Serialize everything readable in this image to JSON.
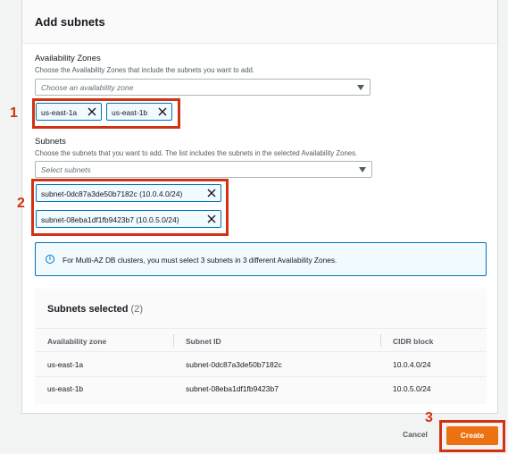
{
  "panel": {
    "title": "Add subnets"
  },
  "az": {
    "label": "Availability Zones",
    "description": "Choose the Availability Zones that include the subnets you want to add.",
    "placeholder": "Choose an availability zone",
    "tokens": [
      "us-east-1a",
      "us-east-1b"
    ]
  },
  "subnets": {
    "label": "Subnets",
    "description": "Choose the subnets that you want to add. The list includes the subnets in the selected Availability Zones.",
    "placeholder": "Select subnets",
    "tokens": [
      "subnet-0dc87a3de50b7182c (10.0.4.0/24)",
      "subnet-08eba1df1fb9423b7 (10.0.5.0/24)"
    ]
  },
  "info": {
    "text": "For Multi-AZ DB clusters, you must select 3 subnets in 3 different Availability Zones."
  },
  "selected": {
    "title": "Subnets selected",
    "count": "(2)",
    "columns": [
      "Availability zone",
      "Subnet ID",
      "CIDR block"
    ],
    "rows": [
      [
        "us-east-1a",
        "subnet-0dc87a3de50b7182c",
        "10.0.4.0/24"
      ],
      [
        "us-east-1b",
        "subnet-08eba1df1fb9423b7",
        "10.0.5.0/24"
      ]
    ]
  },
  "footer": {
    "cancel": "Cancel",
    "create": "Create"
  },
  "annotations": [
    "1",
    "2",
    "3"
  ],
  "colors": {
    "highlight": "#d13212",
    "primary": "#ec7211",
    "accent": "#0073bb"
  }
}
